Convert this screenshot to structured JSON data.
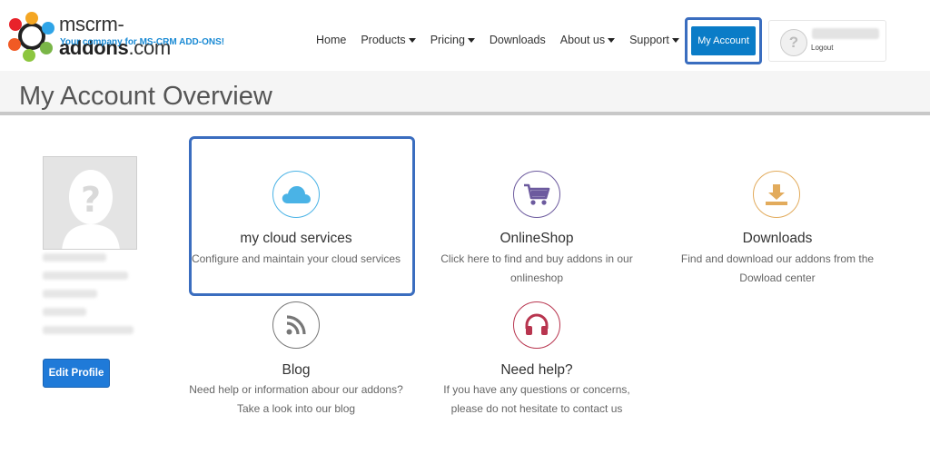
{
  "brand": {
    "name_light": "mscrm-",
    "name_bold": "addons",
    "name_suffix": ".com",
    "tagline": "Your company for MS-CRM ADD-ONS!"
  },
  "nav": {
    "items": [
      {
        "label": "Home",
        "has_caret": false
      },
      {
        "label": "Products",
        "has_caret": true
      },
      {
        "label": "Pricing",
        "has_caret": true
      },
      {
        "label": "Downloads",
        "has_caret": false
      },
      {
        "label": "About us",
        "has_caret": true
      },
      {
        "label": "Support",
        "has_caret": true
      }
    ],
    "my_account": "My Account"
  },
  "user": {
    "logout": "Logout",
    "avatar_glyph": "?"
  },
  "page": {
    "title": "My Account Overview"
  },
  "profile": {
    "edit_button": "Edit Profile"
  },
  "tiles": {
    "cloud": {
      "title": "my cloud services",
      "desc": "Configure and maintain your cloud services",
      "icon": "cloud-icon",
      "color": "#4ab3e6"
    },
    "shop": {
      "title": "OnlineShop",
      "desc": "Click here to find and buy addons in our onlineshop",
      "icon": "shopping-cart-icon",
      "color": "#6c5a9e"
    },
    "downloads": {
      "title": "Downloads",
      "desc": "Find and download our addons from the Dowload center",
      "icon": "download-icon",
      "color": "#e2ab5c"
    },
    "blog": {
      "title": "Blog",
      "desc": "Need help or information abour our addons? Take a look into our blog",
      "icon": "rss-icon",
      "color": "#777777"
    },
    "help": {
      "title": "Need help?",
      "desc": "If you have any questions or concerns, please do not hesitate to contact us",
      "icon": "headphones-icon",
      "color": "#b8354f"
    }
  },
  "colors": {
    "accent": "#0a7cc7",
    "highlight": "#3a6dbf"
  }
}
